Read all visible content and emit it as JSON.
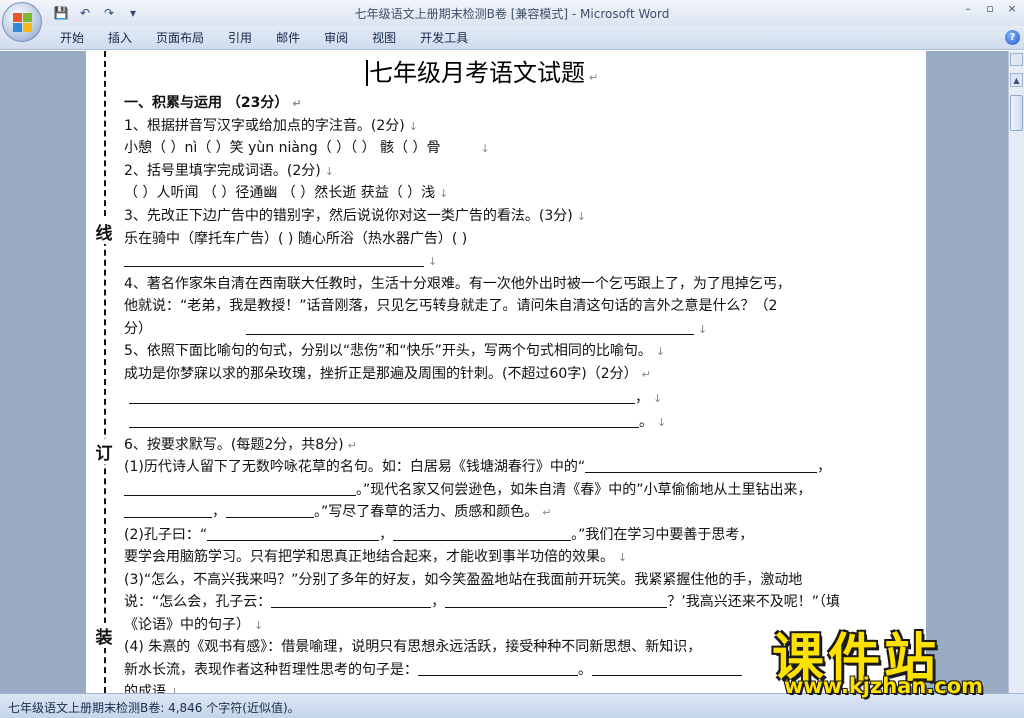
{
  "window": {
    "title": "七年级语文上册期末检测B卷 [兼容模式] - Microsoft Word",
    "minimize": "–",
    "restore": "▫",
    "close": "×"
  },
  "quick_access": {
    "save": "💾",
    "undo": "↶",
    "redo": "↷",
    "customize": "▾"
  },
  "ribbon": {
    "tabs": [
      "开始",
      "插入",
      "页面布局",
      "引用",
      "邮件",
      "审阅",
      "视图",
      "开发工具"
    ],
    "help": "?"
  },
  "document": {
    "title": "七年级月考语文试题",
    "binding_chars": [
      "线",
      "订",
      "装"
    ],
    "lines": [
      "一、积累与运用 （23分）",
      " 1、根据拼音写汉字或给加点的字注音。(2分)",
      "小憩（    ）nì（    ）笑  yùn niàng（    ）（    ）  骸（    ）骨",
      "2、括号里填字完成词语。(2分)",
      "（     ）人听闻 （     ）径通幽 （     ）然长逝 获益（     ）浅",
      "3、先改正下边广告中的错别字，然后说说你对这一类广告的看法。(3分)",
      "乐在骑中（摩托车广告）(        ) 随心所浴（热水器广告）(        )",
      "4、著名作家朱自清在西南联大任教时，生活十分艰难。有一次他外出时被一个乞丐跟上了，为了甩掉乞丐，",
      "他就说：“老弟，我是教授！”话音刚落，只见乞丐转身就走了。请问朱自清这句话的言外之意是什么？（2",
      "分）",
      "5、依照下面比喻句的句式，分别以“悲伤”和“快乐”开头，写两个句式相同的比喻句。",
      "    成功是你梦寐以求的那朵玫瑰，挫折正是那遍及周围的针刺。(不超过60字)（2分）",
      " 6、按要求默写。(每题2分，共8分)",
      "(1)历代诗人留下了无数吟咏花草的名句。如：白居易《钱塘湖春行》中的“",
      "。”现代名家又何尝逊色，如朱自清《春》中的”小草偷偷地从土里钻出来，",
      "，",
      "。”写尽了春草的活力、质感和颜色。",
      "(2)孔子曰：“",
      "，",
      "。”我们在学习中要善于思考，",
      "要学会用脑筋学习。只有把学和思真正地结合起来，才能收到事半功倍的效果。",
      "(3)“怎么，不高兴我来吗？”分别了多年的好友，如今笑盈盈地站在我面前开玩笑。我紧紧握住他的手，激动地",
      "说：“怎么会，孔子云：",
      "，",
      "？’我高兴还来不及呢！”（填",
      "《论语》中的句子）",
      "(4) 朱熹的《观书有感》：借景喻理，说明只有思想永远活跃，接受种种不同新思想、新知识，",
      "新水长流，表现作者这种哲理性思考的句子是：",
      "。",
      "的成语"
    ]
  },
  "statusbar": {
    "text": "七年级语文上册期末检测B卷: 4,846 个字符(近似值)。"
  },
  "watermark": {
    "main": "课件站",
    "url": "www.kjzhan.com"
  },
  "colors": {
    "workspace": "#9aabc4",
    "ribbon": "#cfdcee",
    "watermark": "#ffe100"
  }
}
